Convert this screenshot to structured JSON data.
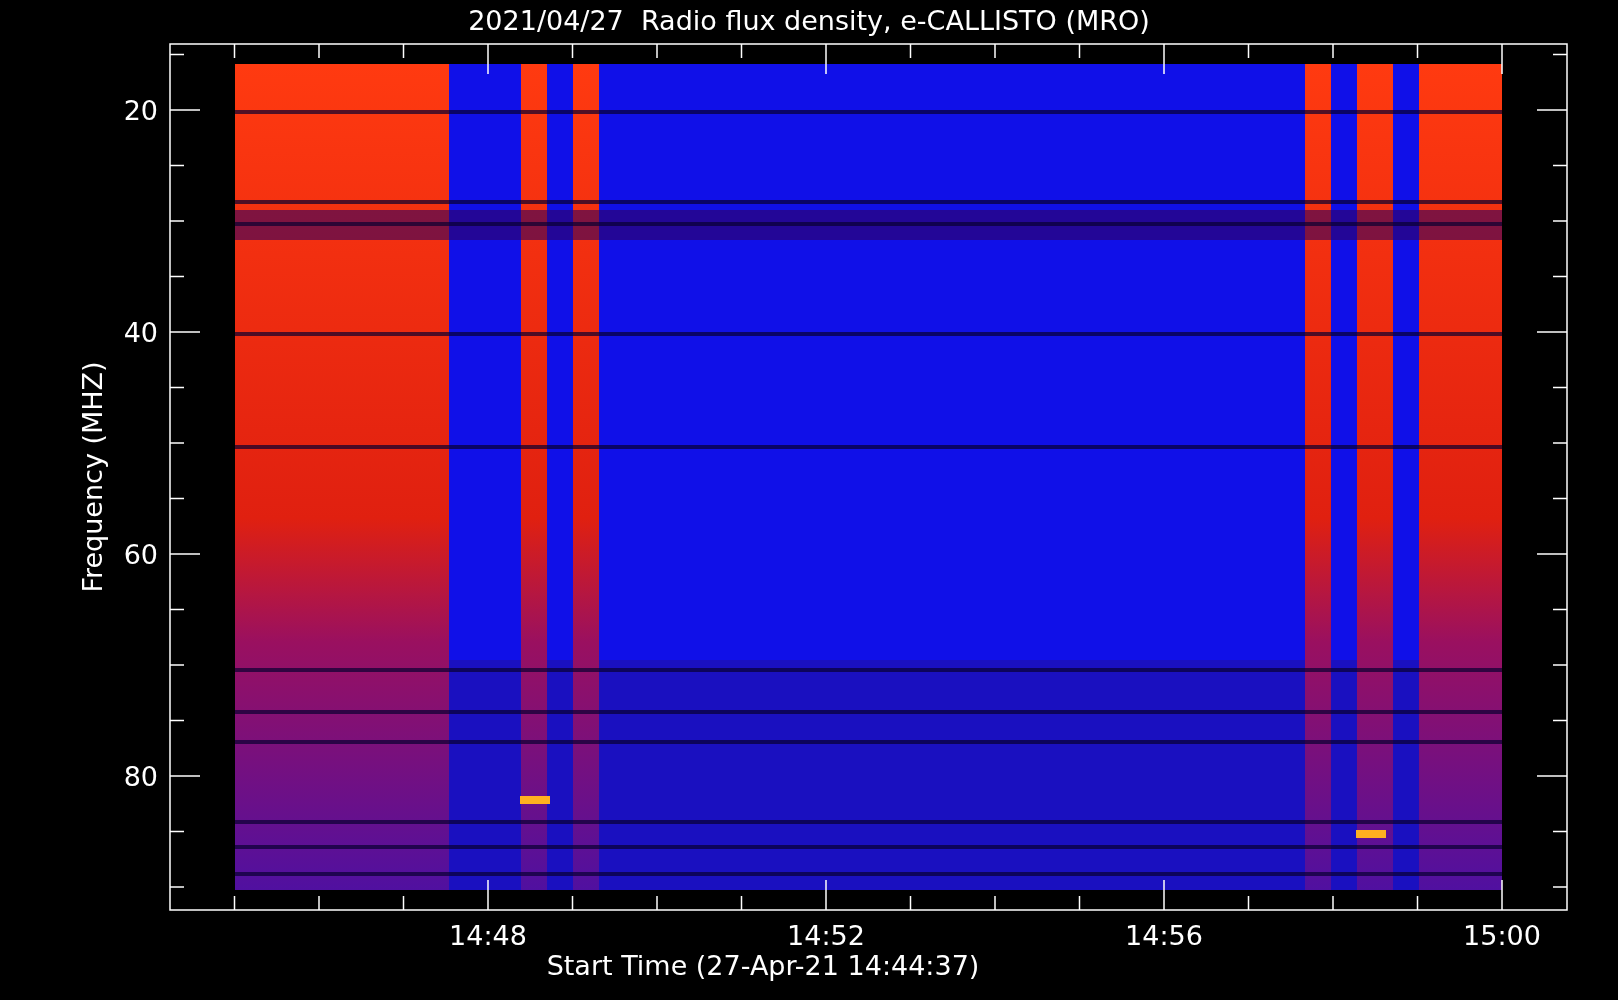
{
  "title": "2021/04/27  Radio flux density, e-CALLISTO (MRO)",
  "y_axis": {
    "label": "Frequency (MHZ)",
    "ticks": [
      "20",
      "40",
      "60",
      "80"
    ]
  },
  "x_axis": {
    "label": "Start Time (27-Apr-21 14:44:37)",
    "ticks": [
      "14:48",
      "14:52",
      "14:56",
      "15:00"
    ]
  }
}
